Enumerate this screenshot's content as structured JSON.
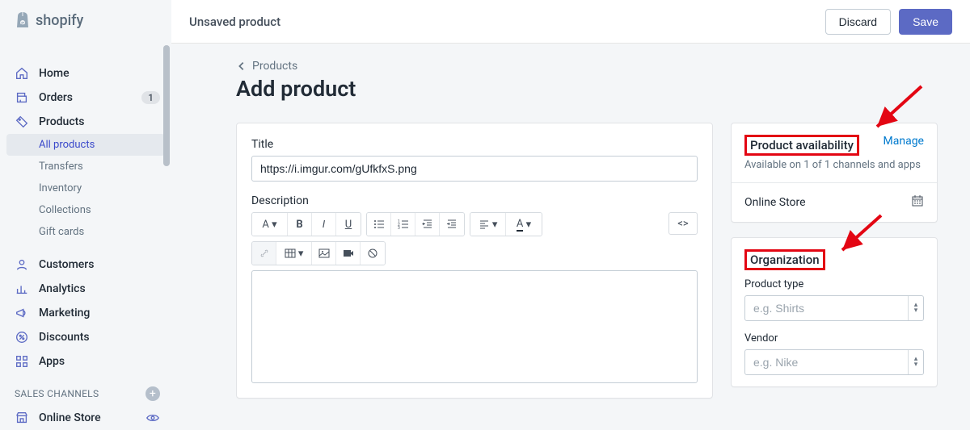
{
  "brand": "shopify",
  "topbar": {
    "title": "Unsaved product",
    "discard": "Discard",
    "save": "Save"
  },
  "nav": {
    "home": "Home",
    "orders": "Orders",
    "orders_badge": "1",
    "products": "Products",
    "all_products": "All products",
    "transfers": "Transfers",
    "inventory": "Inventory",
    "collections": "Collections",
    "gift_cards": "Gift cards",
    "customers": "Customers",
    "analytics": "Analytics",
    "marketing": "Marketing",
    "discounts": "Discounts",
    "apps": "Apps",
    "sales_channels": "SALES CHANNELS",
    "online_store": "Online Store"
  },
  "breadcrumb": "Products",
  "page_title": "Add product",
  "form": {
    "title_label": "Title",
    "title_value": "https://i.imgur.com/gUfkfxS.png",
    "description_label": "Description"
  },
  "rte": {
    "font": "A",
    "bold": "B",
    "italic": "I",
    "underline": "U",
    "code": "<>"
  },
  "availability": {
    "title": "Product availability",
    "manage": "Manage",
    "sub": "Available on 1 of 1 channels and apps",
    "row": "Online Store"
  },
  "organization": {
    "title": "Organization",
    "product_type_label": "Product type",
    "product_type_placeholder": "e.g. Shirts",
    "vendor_label": "Vendor",
    "vendor_placeholder": "e.g. Nike"
  }
}
